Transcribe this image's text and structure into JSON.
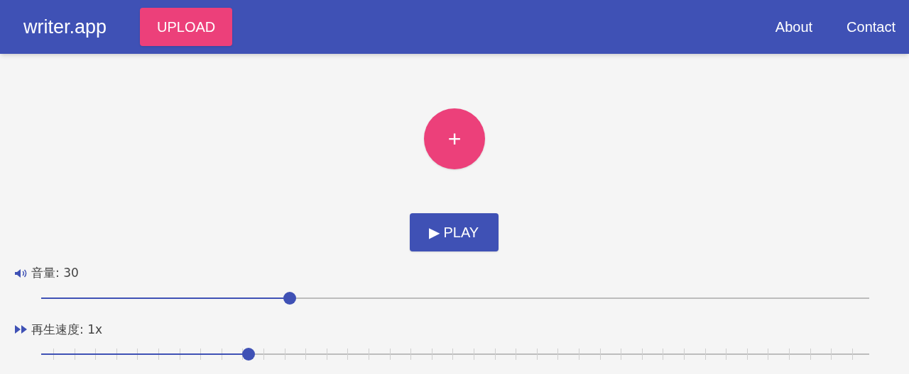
{
  "app_bar": {
    "title": "writer.app",
    "upload_button": "UPLOAD",
    "links": [
      "About",
      "Contact"
    ]
  },
  "add_button": {
    "label": "+"
  },
  "play_button": {
    "label": "▶ PLAY"
  },
  "sliders": [
    {
      "kind": "volume",
      "label": "音量: 30",
      "level": 0.3,
      "ticks": false
    },
    {
      "kind": "speed",
      "label": "再生速度: 1x",
      "level": 0.25,
      "ticks": true
    }
  ]
}
